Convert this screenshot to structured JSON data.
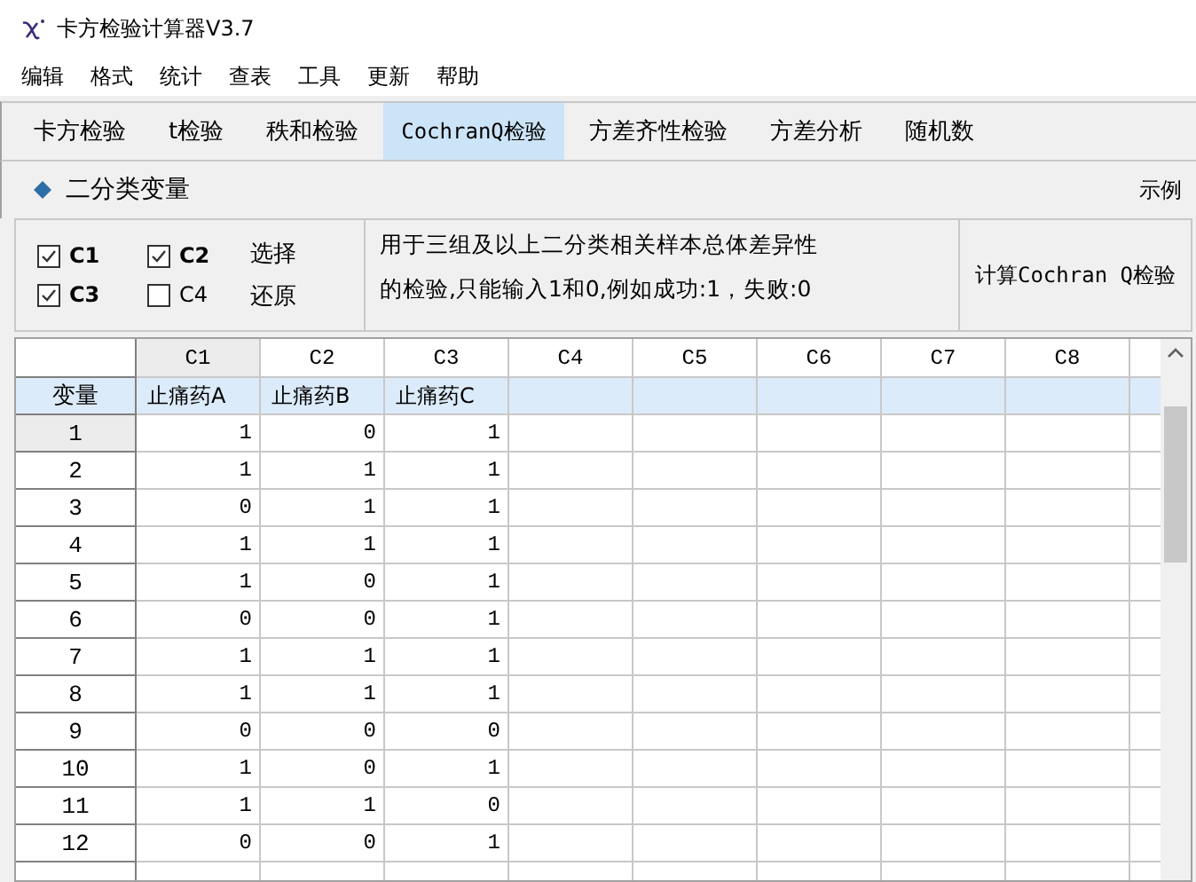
{
  "window": {
    "title": "卡方检验计算器V3.7"
  },
  "menu": [
    "编辑",
    "格式",
    "统计",
    "查表",
    "工具",
    "更新",
    "帮助"
  ],
  "tabs": [
    {
      "label": "卡方检验",
      "selected": false
    },
    {
      "label": "t检验",
      "selected": false
    },
    {
      "label": "秩和检验",
      "selected": false
    },
    {
      "label": "CochranQ检验",
      "selected": true
    },
    {
      "label": "方差齐性检验",
      "selected": false
    },
    {
      "label": "方差分析",
      "selected": false
    },
    {
      "label": "随机数",
      "selected": false
    }
  ],
  "section": {
    "title": "二分类变量",
    "example_link": "示例"
  },
  "options": {
    "checkboxes": [
      {
        "label": "C1",
        "checked": true
      },
      {
        "label": "C2",
        "checked": true
      },
      {
        "label": "C3",
        "checked": true
      },
      {
        "label": "C4",
        "checked": false
      }
    ],
    "buttons": [
      "选择",
      "还原"
    ]
  },
  "description": [
    "用于三组及以上二分类相关样本总体差异性",
    "的检验,只能输入1和0,例如成功:1，失败:0"
  ],
  "calculate_button": "计算Cochran Q检验",
  "grid": {
    "columns": [
      {
        "label": "C1",
        "selected": true
      },
      {
        "label": "C2",
        "selected": false
      },
      {
        "label": "C3",
        "selected": false
      },
      {
        "label": "C4",
        "selected": false
      },
      {
        "label": "C5",
        "selected": false
      },
      {
        "label": "C6",
        "selected": false
      },
      {
        "label": "C7",
        "selected": false
      },
      {
        "label": "C8",
        "selected": false
      }
    ],
    "name_row": {
      "label": "变量",
      "names": [
        "止痛药A",
        "止痛药B",
        "止痛药C"
      ]
    },
    "rows": [
      {
        "label": "1",
        "selected": true,
        "cells": [
          "1",
          "0",
          "1"
        ]
      },
      {
        "label": "2",
        "selected": false,
        "cells": [
          "1",
          "1",
          "1"
        ]
      },
      {
        "label": "3",
        "selected": false,
        "cells": [
          "0",
          "1",
          "1"
        ]
      },
      {
        "label": "4",
        "selected": false,
        "cells": [
          "1",
          "1",
          "1"
        ]
      },
      {
        "label": "5",
        "selected": false,
        "cells": [
          "1",
          "0",
          "1"
        ]
      },
      {
        "label": "6",
        "selected": false,
        "cells": [
          "0",
          "0",
          "1"
        ]
      },
      {
        "label": "7",
        "selected": false,
        "cells": [
          "1",
          "1",
          "1"
        ]
      },
      {
        "label": "8",
        "selected": false,
        "cells": [
          "1",
          "1",
          "1"
        ]
      },
      {
        "label": "9",
        "selected": false,
        "cells": [
          "0",
          "0",
          "0"
        ]
      },
      {
        "label": "10",
        "selected": false,
        "cells": [
          "1",
          "0",
          "1"
        ]
      },
      {
        "label": "11",
        "selected": false,
        "cells": [
          "1",
          "1",
          "0"
        ]
      },
      {
        "label": "12",
        "selected": false,
        "cells": [
          "0",
          "0",
          "1"
        ]
      }
    ]
  }
}
